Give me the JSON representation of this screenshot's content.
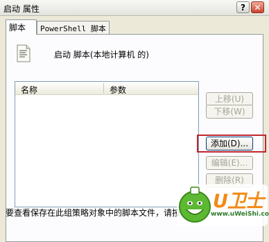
{
  "window": {
    "title": "启动 属性",
    "help_button": "?",
    "close_button": "✕"
  },
  "tabs": [
    {
      "label": "脚本",
      "active": true
    },
    {
      "label": "PowerShell 脚本",
      "active": false
    }
  ],
  "scripts": {
    "header_label": "启动 脚本(本地计算机 的)",
    "columns": [
      "名称",
      "参数"
    ],
    "rows": []
  },
  "buttons": {
    "move_up": "上移(U)",
    "move_down": "下移(W)",
    "add": "添加(D)...",
    "edit": "编辑(E)...",
    "remove": "删除(R)"
  },
  "footer": {
    "text": "要查看保存在此组策略对象中的脚本文件，请按"
  },
  "watermark": {
    "brand": "U卫士",
    "url": "www.uWeiShi.com"
  },
  "colors": {
    "highlight_box": "#c0262d",
    "watermark_brand": "#f28a16"
  }
}
